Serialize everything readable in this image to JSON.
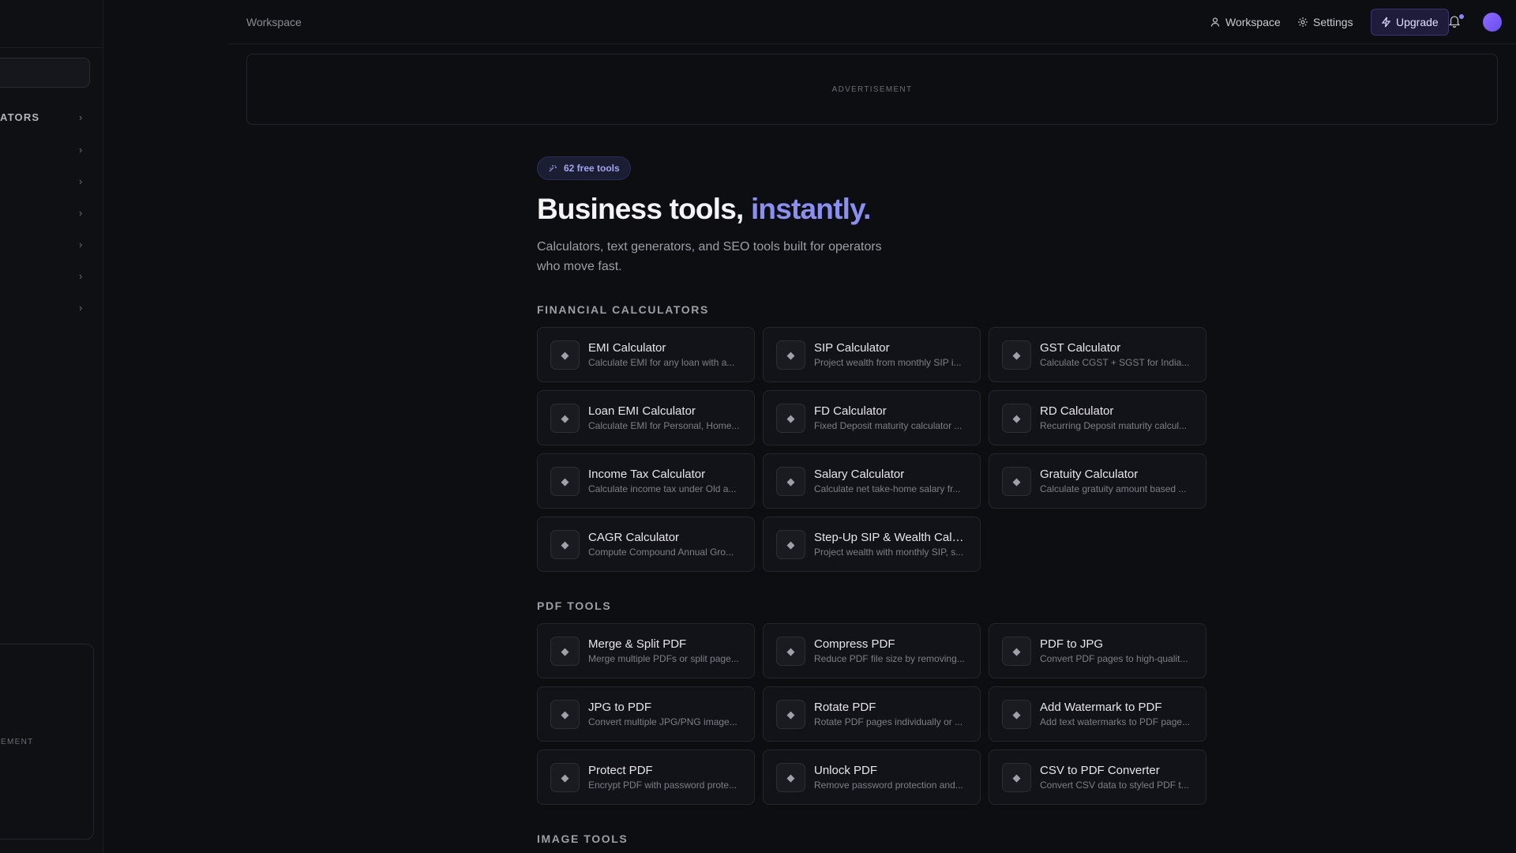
{
  "sidebar": {
    "section_label": "ATORS",
    "ad_label": "EMENT"
  },
  "topbar": {
    "breadcrumb": "Workspace",
    "workspace_label": "Workspace",
    "settings_label": "Settings",
    "upgrade_label": "Upgrade"
  },
  "ad_banner": {
    "label": "ADVERTISEMENT"
  },
  "hero": {
    "badge": "62 free tools",
    "title_main": "Business tools,",
    "title_accent": "instantly.",
    "subtitle": "Calculators, text generators, and SEO tools built for operators who move fast."
  },
  "sections": [
    {
      "title": "FINANCIAL CALCULATORS",
      "tools": [
        {
          "title": "EMI Calculator",
          "desc": "Calculate EMI for any loan with a..."
        },
        {
          "title": "SIP Calculator",
          "desc": "Project wealth from monthly SIP i..."
        },
        {
          "title": "GST Calculator",
          "desc": "Calculate CGST + SGST for India..."
        },
        {
          "title": "Loan EMI Calculator",
          "desc": "Calculate EMI for Personal, Home..."
        },
        {
          "title": "FD Calculator",
          "desc": "Fixed Deposit maturity calculator ..."
        },
        {
          "title": "RD Calculator",
          "desc": "Recurring Deposit maturity calcul..."
        },
        {
          "title": "Income Tax Calculator",
          "desc": "Calculate income tax under Old a..."
        },
        {
          "title": "Salary Calculator",
          "desc": "Calculate net take-home salary fr..."
        },
        {
          "title": "Gratuity Calculator",
          "desc": "Calculate gratuity amount based ..."
        },
        {
          "title": "CAGR Calculator",
          "desc": "Compute Compound Annual Gro..."
        },
        {
          "title": "Step-Up SIP & Wealth Calcu...",
          "desc": "Project wealth with monthly SIP, s..."
        }
      ]
    },
    {
      "title": "PDF TOOLS",
      "tools": [
        {
          "title": "Merge & Split PDF",
          "desc": "Merge multiple PDFs or split page..."
        },
        {
          "title": "Compress PDF",
          "desc": "Reduce PDF file size by removing..."
        },
        {
          "title": "PDF to JPG",
          "desc": "Convert PDF pages to high-qualit..."
        },
        {
          "title": "JPG to PDF",
          "desc": "Convert multiple JPG/PNG image..."
        },
        {
          "title": "Rotate PDF",
          "desc": "Rotate PDF pages individually or ..."
        },
        {
          "title": "Add Watermark to PDF",
          "desc": "Add text watermarks to PDF page..."
        },
        {
          "title": "Protect PDF",
          "desc": "Encrypt PDF with password prote..."
        },
        {
          "title": "Unlock PDF",
          "desc": "Remove password protection and..."
        },
        {
          "title": "CSV to PDF Converter",
          "desc": "Convert CSV data to styled PDF t..."
        }
      ]
    },
    {
      "title": "IMAGE TOOLS",
      "tools": []
    }
  ],
  "icons": {
    "tool_icon": "diamond-icon",
    "chevron": "chevron-right-icon"
  }
}
